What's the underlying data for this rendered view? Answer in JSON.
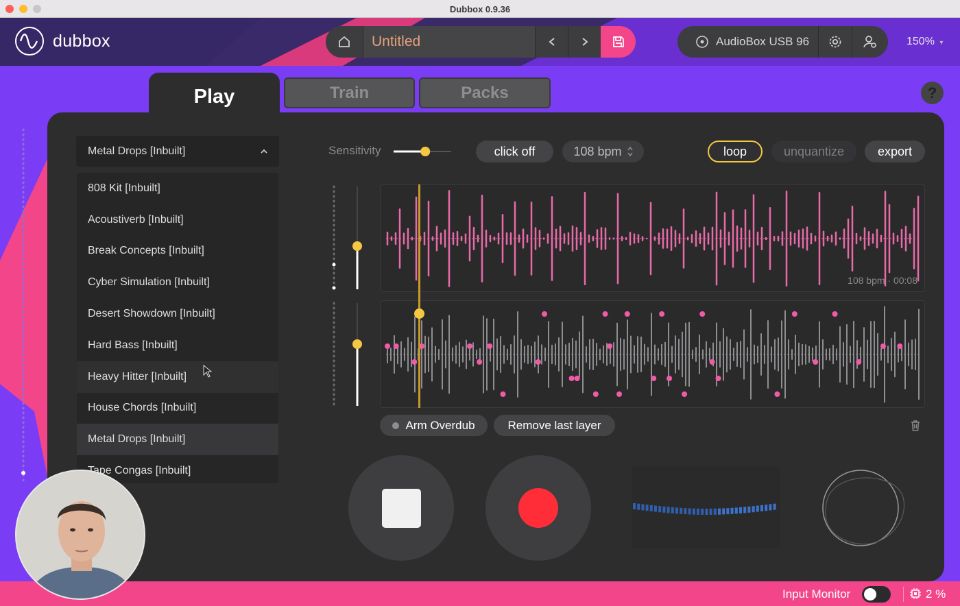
{
  "window": {
    "title": "Dubbox 0.9.36"
  },
  "header": {
    "logo_text": "dubbox",
    "project_name": "Untitled",
    "device_name": "AudioBox USB 96",
    "zoom": "150%"
  },
  "tabs": [
    {
      "label": "Play",
      "active": true
    },
    {
      "label": "Train",
      "active": false
    },
    {
      "label": "Packs",
      "active": false
    }
  ],
  "help_label": "?",
  "pack_select": {
    "selected": "Metal Drops [Inbuilt]",
    "options": [
      "808 Kit [Inbuilt]",
      "Acoustiverb [Inbuilt]",
      "Break Concepts [Inbuilt]",
      "Cyber Simulation [Inbuilt]",
      "Desert Showdown [Inbuilt]",
      "Hard Bass [Inbuilt]",
      "Heavy Hitter [Inbuilt]",
      "House Chords [Inbuilt]",
      "Metal Drops [Inbuilt]",
      "Tape Congas [Inbuilt]"
    ],
    "hovered_index": 6,
    "selected_index": 8
  },
  "controls": {
    "sensitivity_label": "Sensitivity",
    "sensitivity_value": 0.55,
    "click_label": "click off",
    "bpm_label": "108 bpm",
    "loop_label": "loop",
    "unquantize_label": "unquantize",
    "export_label": "export"
  },
  "track1": {
    "info": "108 bpm · 00:08",
    "volume": 0.42
  },
  "track2": {
    "volume": 0.6
  },
  "overdub": {
    "arm_label": "Arm Overdub",
    "remove_label": "Remove last layer"
  },
  "footer": {
    "input_monitor_label": "Input Monitor",
    "input_monitor_on": false,
    "cpu": "2 %"
  },
  "colors": {
    "accent_pink": "#f3468a",
    "wave_pink": "#e86aa8",
    "playhead": "#f5c842",
    "record_red": "#ff2d37",
    "purple_bg": "#7b3cf5"
  }
}
